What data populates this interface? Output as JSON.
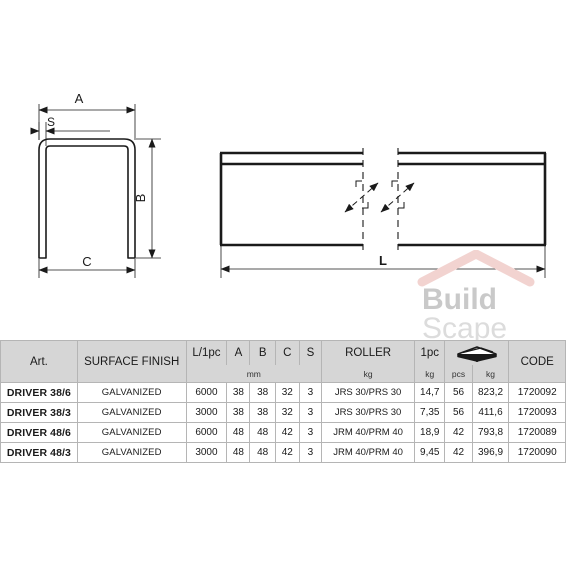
{
  "drawing": {
    "cross_section": {
      "name": "u-channel-cross-section",
      "dim_a": "A",
      "dim_s": "S",
      "dim_b": "B",
      "dim_c": "C"
    },
    "side_view": {
      "name": "channel-side-elevation",
      "dim_l": "L"
    }
  },
  "watermark": {
    "line1": "Build",
    "line2": "Scape",
    "roof_color": "#f2d3d0",
    "text_color_bold": "#c9c9c9",
    "text_color_light": "#dcdcdc"
  },
  "table": {
    "header": [
      "Art.",
      "SURFACE FINISH",
      "L/1pc",
      "A",
      "B",
      "C",
      "S",
      "ROLLER",
      "1pc",
      "pallet-icon",
      "CODE"
    ],
    "subheader": {
      "art": "",
      "surface_finish": "",
      "mm": "mm",
      "roller_kg": "kg",
      "onepc_kg": "kg",
      "pallet_pcs": "pcs",
      "pallet_kg": "kg",
      "code": ""
    },
    "rows": [
      {
        "art": "DRIVER 38/6",
        "surface_finish": "GALVANIZED",
        "l_1pc": "6000",
        "a": "38",
        "b": "38",
        "c": "32",
        "s": "3",
        "roller": "JRS 30/PRS 30",
        "weight_1pc": "14,7",
        "pallet_pcs": "56",
        "pallet_kg": "823,2",
        "code": "1720092"
      },
      {
        "art": "DRIVER 38/3",
        "surface_finish": "GALVANIZED",
        "l_1pc": "3000",
        "a": "38",
        "b": "38",
        "c": "32",
        "s": "3",
        "roller": "JRS 30/PRS 30",
        "weight_1pc": "7,35",
        "pallet_pcs": "56",
        "pallet_kg": "411,6",
        "code": "1720093"
      },
      {
        "art": "DRIVER 48/6",
        "surface_finish": "GALVANIZED",
        "l_1pc": "6000",
        "a": "48",
        "b": "48",
        "c": "42",
        "s": "3",
        "roller": "JRM 40/PRM 40",
        "weight_1pc": "18,9",
        "pallet_pcs": "42",
        "pallet_kg": "793,8",
        "code": "1720089"
      },
      {
        "art": "DRIVER 48/3",
        "surface_finish": "GALVANIZED",
        "l_1pc": "3000",
        "a": "48",
        "b": "48",
        "c": "42",
        "s": "3",
        "roller": "JRM 40/PRM 40",
        "weight_1pc": "9,45",
        "pallet_pcs": "42",
        "pallet_kg": "396,9",
        "code": "1720090"
      }
    ]
  }
}
